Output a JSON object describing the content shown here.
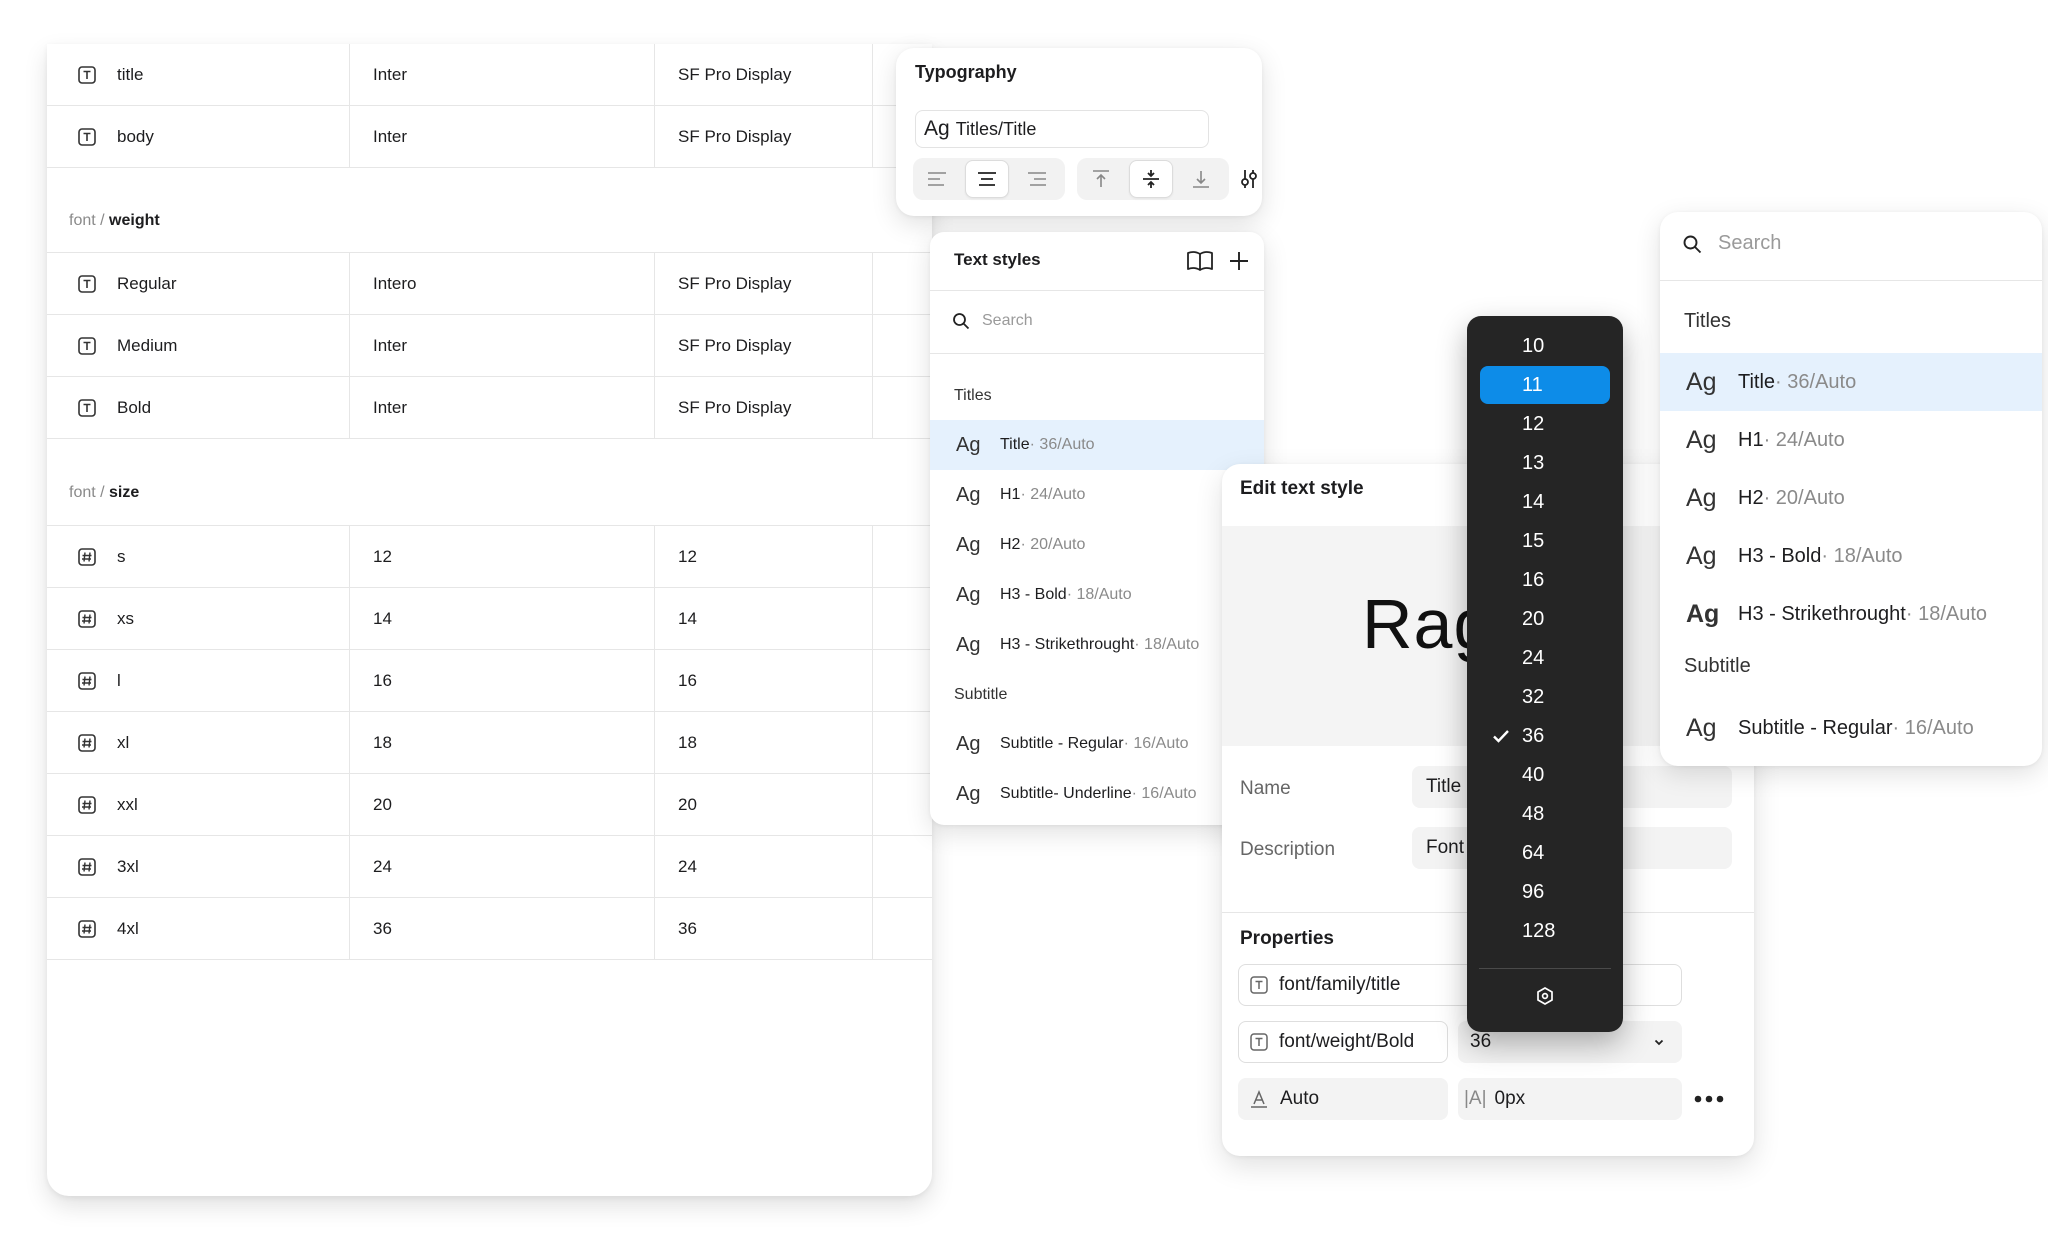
{
  "variables_table": {
    "rows_top": [
      {
        "name": "title",
        "mode1": "Inter",
        "mode2": "SF Pro Display"
      },
      {
        "name": "body",
        "mode1": "Inter",
        "mode2": "SF Pro Display"
      }
    ],
    "weight_group": {
      "prefix": "font / ",
      "name": "weight"
    },
    "weight_rows": [
      {
        "name": "Regular",
        "mode1": "Intero",
        "mode2": "SF Pro Display"
      },
      {
        "name": "Medium",
        "mode1": "Inter",
        "mode2": "SF Pro Display"
      },
      {
        "name": "Bold",
        "mode1": "Inter",
        "mode2": "SF Pro Display"
      }
    ],
    "size_group": {
      "prefix": "font / ",
      "name": "size"
    },
    "size_rows": [
      {
        "name": "s",
        "mode1": "12",
        "mode2": "12"
      },
      {
        "name": "xs",
        "mode1": "14",
        "mode2": "14"
      },
      {
        "name": "l",
        "mode1": "16",
        "mode2": "16"
      },
      {
        "name": "xl",
        "mode1": "18",
        "mode2": "18"
      },
      {
        "name": "xxl",
        "mode1": "20",
        "mode2": "20"
      },
      {
        "name": "3xl",
        "mode1": "24",
        "mode2": "24"
      },
      {
        "name": "4xl",
        "mode1": "36",
        "mode2": "36"
      }
    ]
  },
  "typography": {
    "title": "Typography",
    "style_prefix": "Ag",
    "style_value": "Titles/Title"
  },
  "text_styles": {
    "title": "Text styles",
    "search_placeholder": "Search",
    "section_titles": "Titles",
    "section_subtitle": "Subtitle",
    "items": [
      {
        "ag": "Ag",
        "name": "Title",
        "meta": " · 36/Auto"
      },
      {
        "ag": "Ag",
        "name": "H1",
        "meta": " · 24/Auto"
      },
      {
        "ag": "Ag",
        "name": "H2",
        "meta": " · 20/Auto"
      },
      {
        "ag": "Ag",
        "name": "H3 - Bold",
        "meta": " · 18/Auto"
      },
      {
        "ag": "Ag",
        "name": "H3 - Strikethrought",
        "meta": " · 18/Auto"
      },
      {
        "ag": "Ag",
        "name": "Subtitle - Regular",
        "meta": " · 16/Auto"
      },
      {
        "ag": "Ag",
        "name": "Subtitle-  Underline",
        "meta": " · 16/Auto"
      }
    ]
  },
  "edit_style": {
    "title": "Edit text style",
    "preview": "Rag",
    "name_label": "Name",
    "name_value": "Title",
    "description_label": "Description",
    "description_value": "Font for titles",
    "properties_title": "Properties",
    "family": "font/family/title",
    "weight": "font/weight/Bold",
    "size": "36",
    "line_height": "Auto",
    "letter_spacing_icon": "|A|",
    "letter_spacing": "0px"
  },
  "font_sizes": {
    "options": [
      "10",
      "11",
      "12",
      "13",
      "14",
      "15",
      "16",
      "20",
      "24",
      "32",
      "36",
      "40",
      "48",
      "64",
      "96",
      "128"
    ],
    "highlighted": "11",
    "checked": "36"
  },
  "right_panel": {
    "search_placeholder": "Search",
    "section_titles": "Titles",
    "section_subtitle": "Subtitle",
    "items": [
      {
        "ag": "Ag",
        "name": "Title",
        "meta": " · 36/Auto"
      },
      {
        "ag": "Ag",
        "name": "H1",
        "meta": " · 24/Auto"
      },
      {
        "ag": "Ag",
        "name": "H2",
        "meta": " · 20/Auto"
      },
      {
        "ag": "Ag",
        "name": "H3 - Bold",
        "meta": " · 18/Auto"
      },
      {
        "ag": "Ag",
        "name": "H3 - Strikethrought",
        "meta": " · 18/Auto"
      },
      {
        "ag": "Ag",
        "name": "Subtitle - Regular",
        "meta": " · 16/Auto"
      }
    ]
  },
  "colors": {
    "accent": "#0d8ce8",
    "selection": "#e5f1fd",
    "dropdown_bg": "#252525"
  }
}
